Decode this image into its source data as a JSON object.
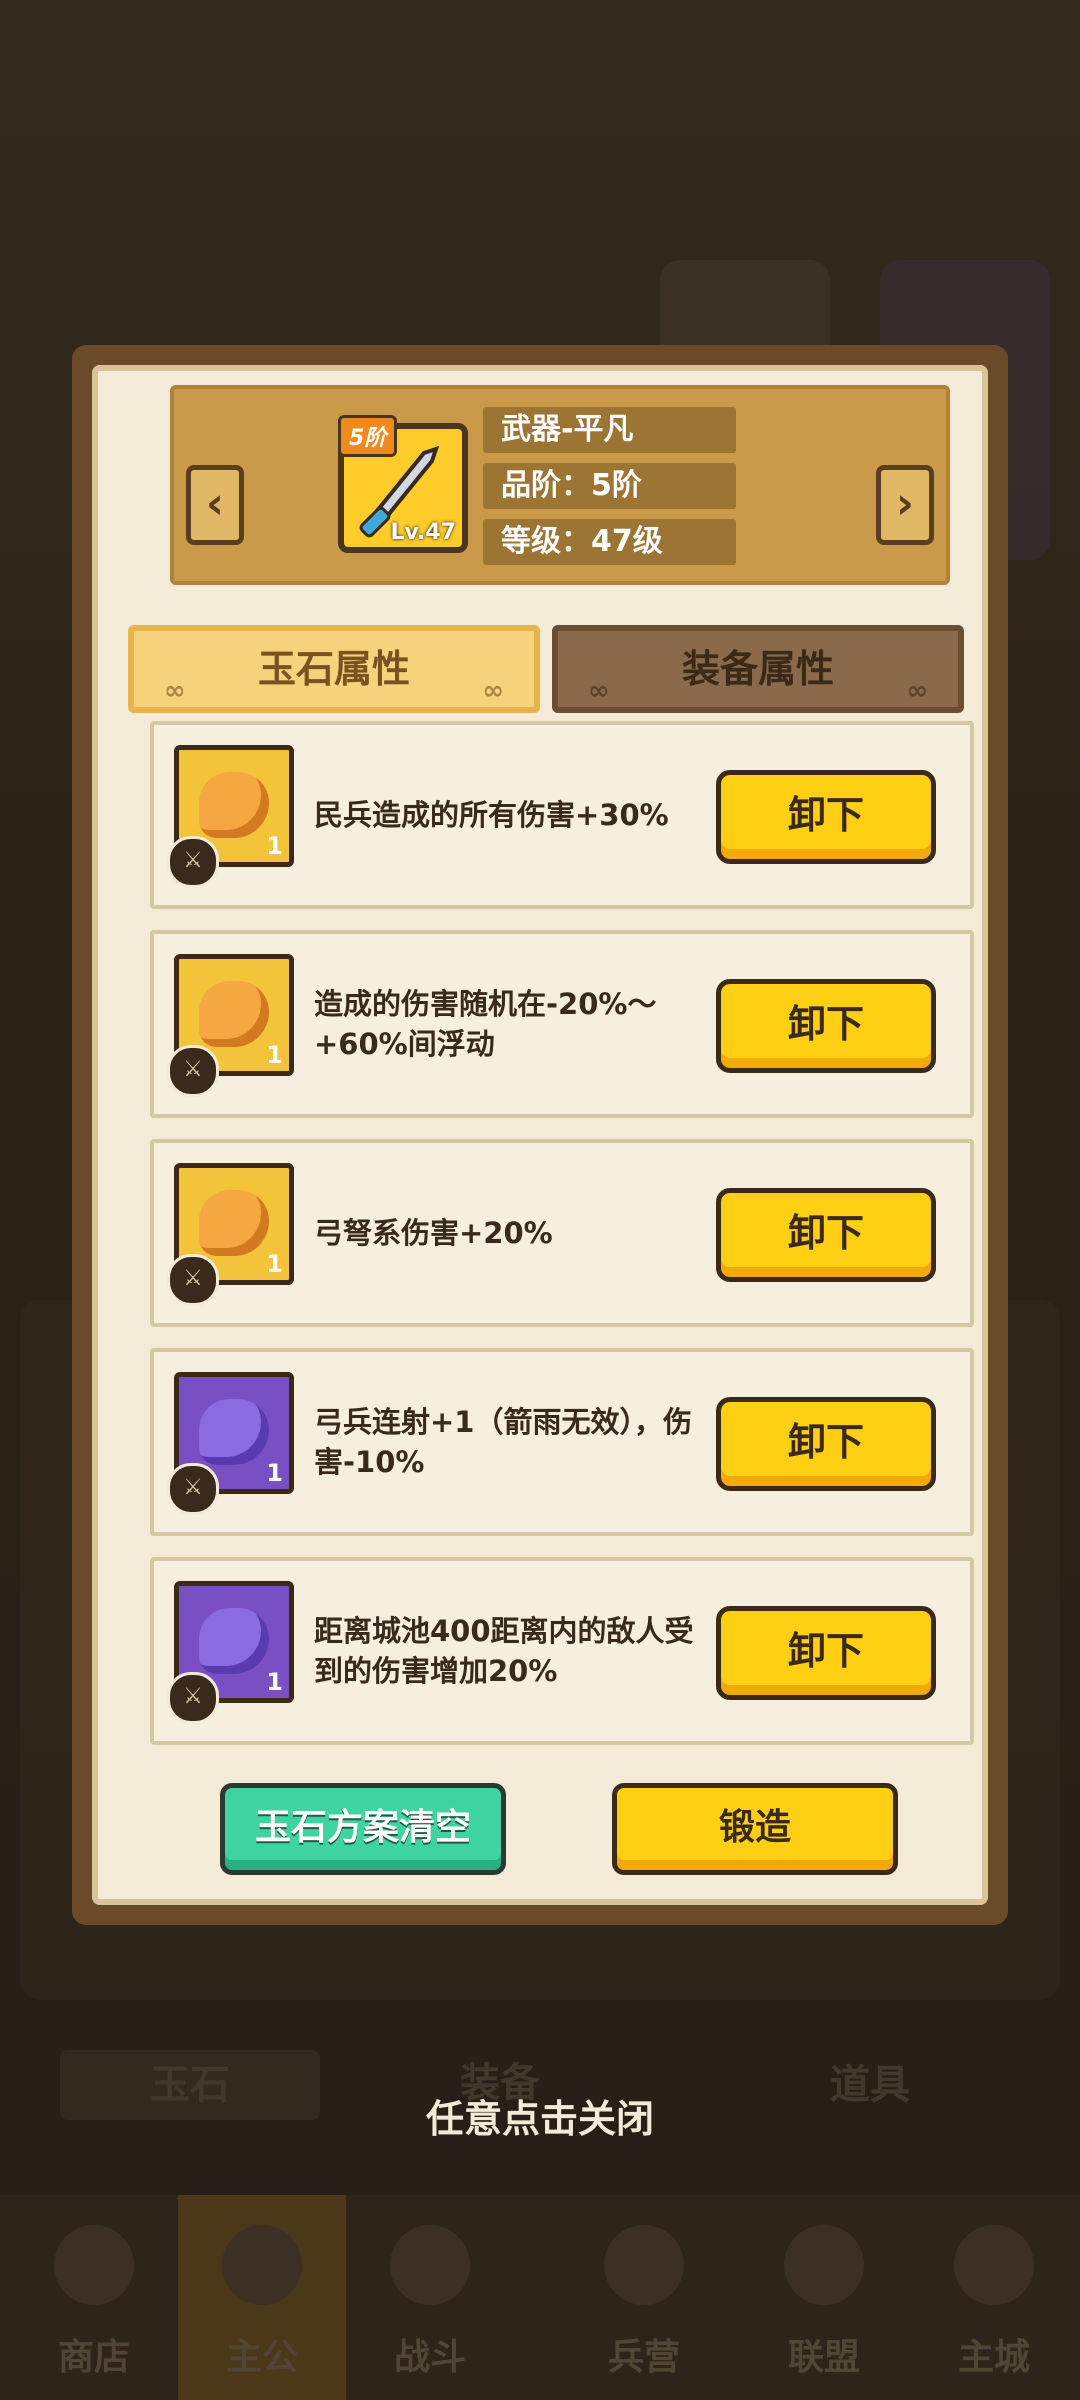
{
  "colors": {
    "modal_frame": "#6b4a2a",
    "gold_button": "#ffcf14",
    "green_button": "#3fd3a2",
    "gem_gold": "#f3c33a",
    "gem_purple": "#7a4fc4"
  },
  "background": {
    "tabs": [
      "玉石",
      "装备",
      "道具"
    ],
    "nav": [
      "商店",
      "主公",
      "战斗",
      "兵营",
      "联盟",
      "主城"
    ],
    "active_nav": "主公"
  },
  "equipment": {
    "tier_badge": "5阶",
    "level_badge": "Lv.47",
    "name": "武器-平凡",
    "quality": "品阶：5阶",
    "level": "等级：47级",
    "icon": "sword-icon"
  },
  "tabs": {
    "active": "玉石属性",
    "inactive": "装备属性"
  },
  "gems": [
    {
      "type": "gold",
      "count": "1",
      "text": "民兵造成的所有伤害+30%",
      "button": "卸下"
    },
    {
      "type": "gold",
      "count": "1",
      "text": "造成的伤害随机在-20%～+60%间浮动",
      "button": "卸下"
    },
    {
      "type": "gold",
      "count": "1",
      "text": "弓弩系伤害+20%",
      "button": "卸下"
    },
    {
      "type": "purple",
      "count": "1",
      "text": "弓兵连射+1（箭雨无效），伤害-10%",
      "button": "卸下"
    },
    {
      "type": "purple",
      "count": "1",
      "text": "距离城池400距离内的敌人受到的伤害增加20%",
      "button": "卸下"
    }
  ],
  "actions": {
    "clear": "玉石方案清空",
    "forge": "锻造"
  },
  "close_hint": "任意点击关闭"
}
